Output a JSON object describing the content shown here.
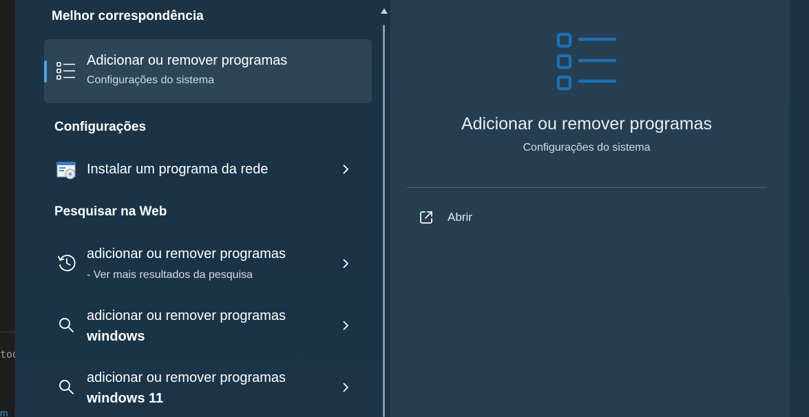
{
  "background_window": {
    "fragment_text": "tod",
    "fragment_link": "m"
  },
  "results": {
    "best_match_heading": "Melhor correspondência",
    "best_match": {
      "title": "Adicionar ou remover programas",
      "subtitle": "Configurações do sistema",
      "icon": "list-settings-icon"
    },
    "settings_heading": "Configurações",
    "settings_items": [
      {
        "label": "Instalar um programa da rede",
        "icon": "network-install-icon"
      }
    ],
    "web_heading": "Pesquisar na Web",
    "web_items": [
      {
        "line1": "adicionar ou remover programas",
        "line2": "- Ver mais resultados da pesquisa",
        "icon": "history-icon"
      },
      {
        "line1": "adicionar ou remover programas",
        "line2": "windows",
        "icon": "search-icon"
      },
      {
        "line1": "adicionar ou remover programas",
        "line2": "windows 11",
        "icon": "search-icon"
      }
    ]
  },
  "preview": {
    "title": "Adicionar ou remover programas",
    "subtitle": "Configurações do sistema",
    "action_open": "Abrir"
  },
  "colors": {
    "accent": "#4aa3e8",
    "icon_blue": "#1f6fb2",
    "panel_bg": "#1b3345",
    "preview_bg": "#263e51",
    "selected_bg": "#2c4658"
  }
}
